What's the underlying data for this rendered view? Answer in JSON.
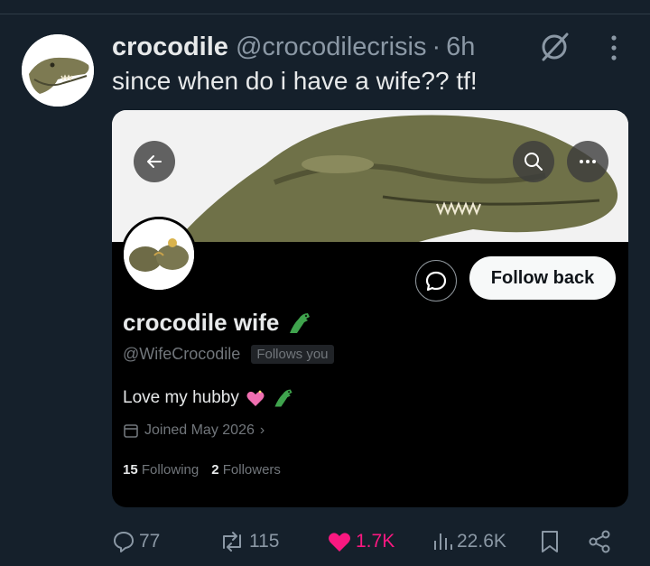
{
  "tweet": {
    "display_name": "crocodile",
    "handle": "@crocodilecrisis",
    "separator": "·",
    "time": "6h",
    "text": "since when do i have a wife?? tf!"
  },
  "profile_card": {
    "name": "crocodile wife",
    "handle": "@WifeCrocodile",
    "follows_you": "Follows you",
    "bio": "Love my hubby",
    "joined": "Joined May 2026",
    "follow_back_label": "Follow back",
    "following_count": "15",
    "following_label": "Following",
    "followers_count": "2",
    "followers_label": "Followers"
  },
  "actions": {
    "replies": "77",
    "retweets": "115",
    "likes": "1.7K",
    "views": "22.6K"
  },
  "colors": {
    "background": "#15202b",
    "like": "#f91880",
    "muted": "#8b98a5"
  },
  "icons": [
    "grok-icon",
    "more-icon",
    "back-arrow-icon",
    "search-icon",
    "ellipsis-icon",
    "message-icon",
    "crocodile-emoji-icon",
    "heart-emoji-icon",
    "calendar-icon",
    "reply-icon",
    "retweet-icon",
    "like-icon",
    "views-icon",
    "bookmark-icon",
    "share-icon"
  ]
}
